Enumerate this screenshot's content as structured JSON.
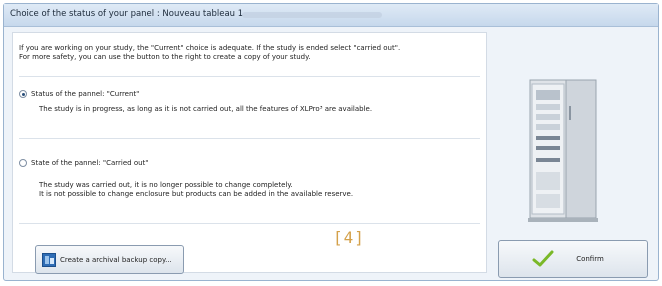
{
  "dialog": {
    "title": "Choice of the status of your panel : Nouveau tableau 1",
    "intro_line1": "If you are working on your study, the \"Current\" choice is adequate. If the study is ended select \"carried out\".",
    "intro_line2": "For more safety, you can use the button to the right to create a copy of your study.",
    "option_current": {
      "label": "Status of the pannel: \"Current\"",
      "description": "The study is in progress, as long as it is not carried out, all the features of XLPro³ are available.",
      "selected": true
    },
    "option_carried_out": {
      "label": "State of the pannel: \"Carried out\"",
      "description_line1": "The study was carried out, it is no longer possible to change completely.",
      "description_line2": "It is not possible to change enclosure but products can be added in the available reserve.",
      "selected": false
    },
    "archive_button_label": "Create a archival backup copy...",
    "confirm_button_label": "Confirm",
    "caption": "[4]"
  },
  "colors": {
    "accent_check": "#7ab828",
    "caption": "#d4a14a"
  }
}
